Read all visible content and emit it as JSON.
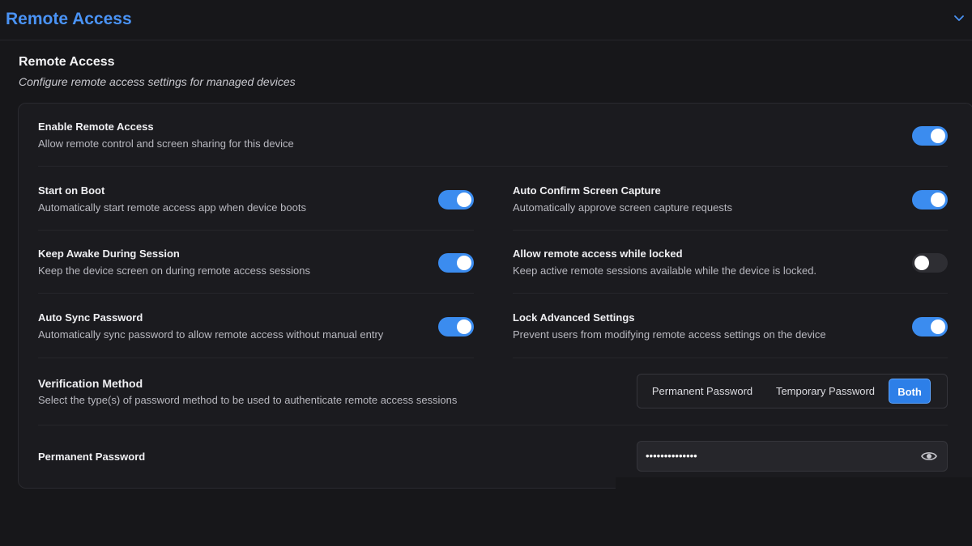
{
  "header": {
    "title": "Remote Access",
    "chevron_icon": "chevron-down-icon"
  },
  "section": {
    "title": "Remote Access",
    "subtitle": "Configure remote access settings for managed devices"
  },
  "settings": {
    "enable_remote": {
      "title": "Enable Remote Access",
      "desc": "Allow remote control and screen sharing for this device",
      "on": true
    },
    "start_on_boot": {
      "title": "Start on Boot",
      "desc": "Automatically start remote access app when device boots",
      "on": true
    },
    "auto_confirm": {
      "title": "Auto Confirm Screen Capture",
      "desc": "Automatically approve screen capture requests",
      "on": true
    },
    "keep_awake": {
      "title": "Keep Awake During Session",
      "desc": "Keep the device screen on during remote access sessions",
      "on": true
    },
    "allow_locked": {
      "title": "Allow remote access while locked",
      "desc": "Keep active remote sessions available while the device is locked.",
      "on": false
    },
    "auto_sync": {
      "title": "Auto Sync Password",
      "desc": "Automatically sync password to allow remote access without manual entry",
      "on": true
    },
    "lock_advanced": {
      "title": "Lock Advanced Settings",
      "desc": "Prevent users from modifying remote access settings on the device",
      "on": true
    }
  },
  "verification": {
    "title": "Verification Method",
    "desc": "Select the type(s) of password method to be used to authenticate remote access sessions",
    "options": [
      "Permanent Password",
      "Temporary Password",
      "Both"
    ],
    "selected": "Both"
  },
  "permanent_password": {
    "label": "Permanent Password",
    "value": "••••••••••••••",
    "icon": "eye-icon"
  },
  "colors": {
    "accent": "#3b8cef",
    "header_title": "#4a93f5",
    "background": "#17171a"
  }
}
